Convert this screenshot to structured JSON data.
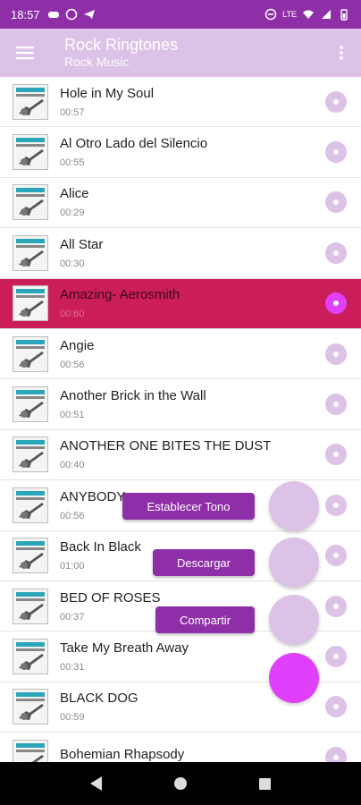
{
  "status_bar": {
    "time": "18:57",
    "network": "LTE"
  },
  "app_bar": {
    "title": "Rock Ringtones",
    "subtitle": "Rock Music",
    "menu_icon": "menu-icon",
    "more_icon": "more-vert-icon"
  },
  "colors": {
    "status_bar": "#8e2fa8",
    "app_bar": "#dcc2e7",
    "selected_row": "#cb1d5a",
    "accent": "#e040fb",
    "label_bg": "#8e2fa8"
  },
  "songs": [
    {
      "title": "Hole in My Soul",
      "duration": "00:57",
      "selected": false
    },
    {
      "title": "Al Otro Lado del Silencio",
      "duration": "00:55",
      "selected": false
    },
    {
      "title": "Alice",
      "duration": "00:29",
      "selected": false
    },
    {
      "title": "All Star",
      "duration": "00:30",
      "selected": false
    },
    {
      "title": "Amazing- Aerosmith",
      "duration": "00:60",
      "selected": true
    },
    {
      "title": "Angie",
      "duration": "00:56",
      "selected": false
    },
    {
      "title": "Another Brick in the Wall",
      "duration": "00:51",
      "selected": false
    },
    {
      "title": "ANOTHER ONE BITES THE DUST",
      "duration": "00:40",
      "selected": false
    },
    {
      "title": "ANYBODY",
      "duration": "00:56",
      "selected": false
    },
    {
      "title": "Back In Black",
      "duration": "01:00",
      "selected": false
    },
    {
      "title": "BED OF ROSES",
      "duration": "00:37",
      "selected": false
    },
    {
      "title": "Take My Breath Away",
      "duration": "00:31",
      "selected": false
    },
    {
      "title": "BLACK DOG",
      "duration": "00:59",
      "selected": false
    },
    {
      "title": "Bohemian Rhapsody",
      "duration": "",
      "selected": false
    }
  ],
  "fab_menu": {
    "set_tone_label": "Establecer Tono",
    "download_label": "Descargar",
    "share_label": "Compartir"
  },
  "nav_bar": {
    "back_icon": "back-triangle-icon",
    "home_icon": "home-circle-icon",
    "recents_icon": "recents-square-icon"
  }
}
